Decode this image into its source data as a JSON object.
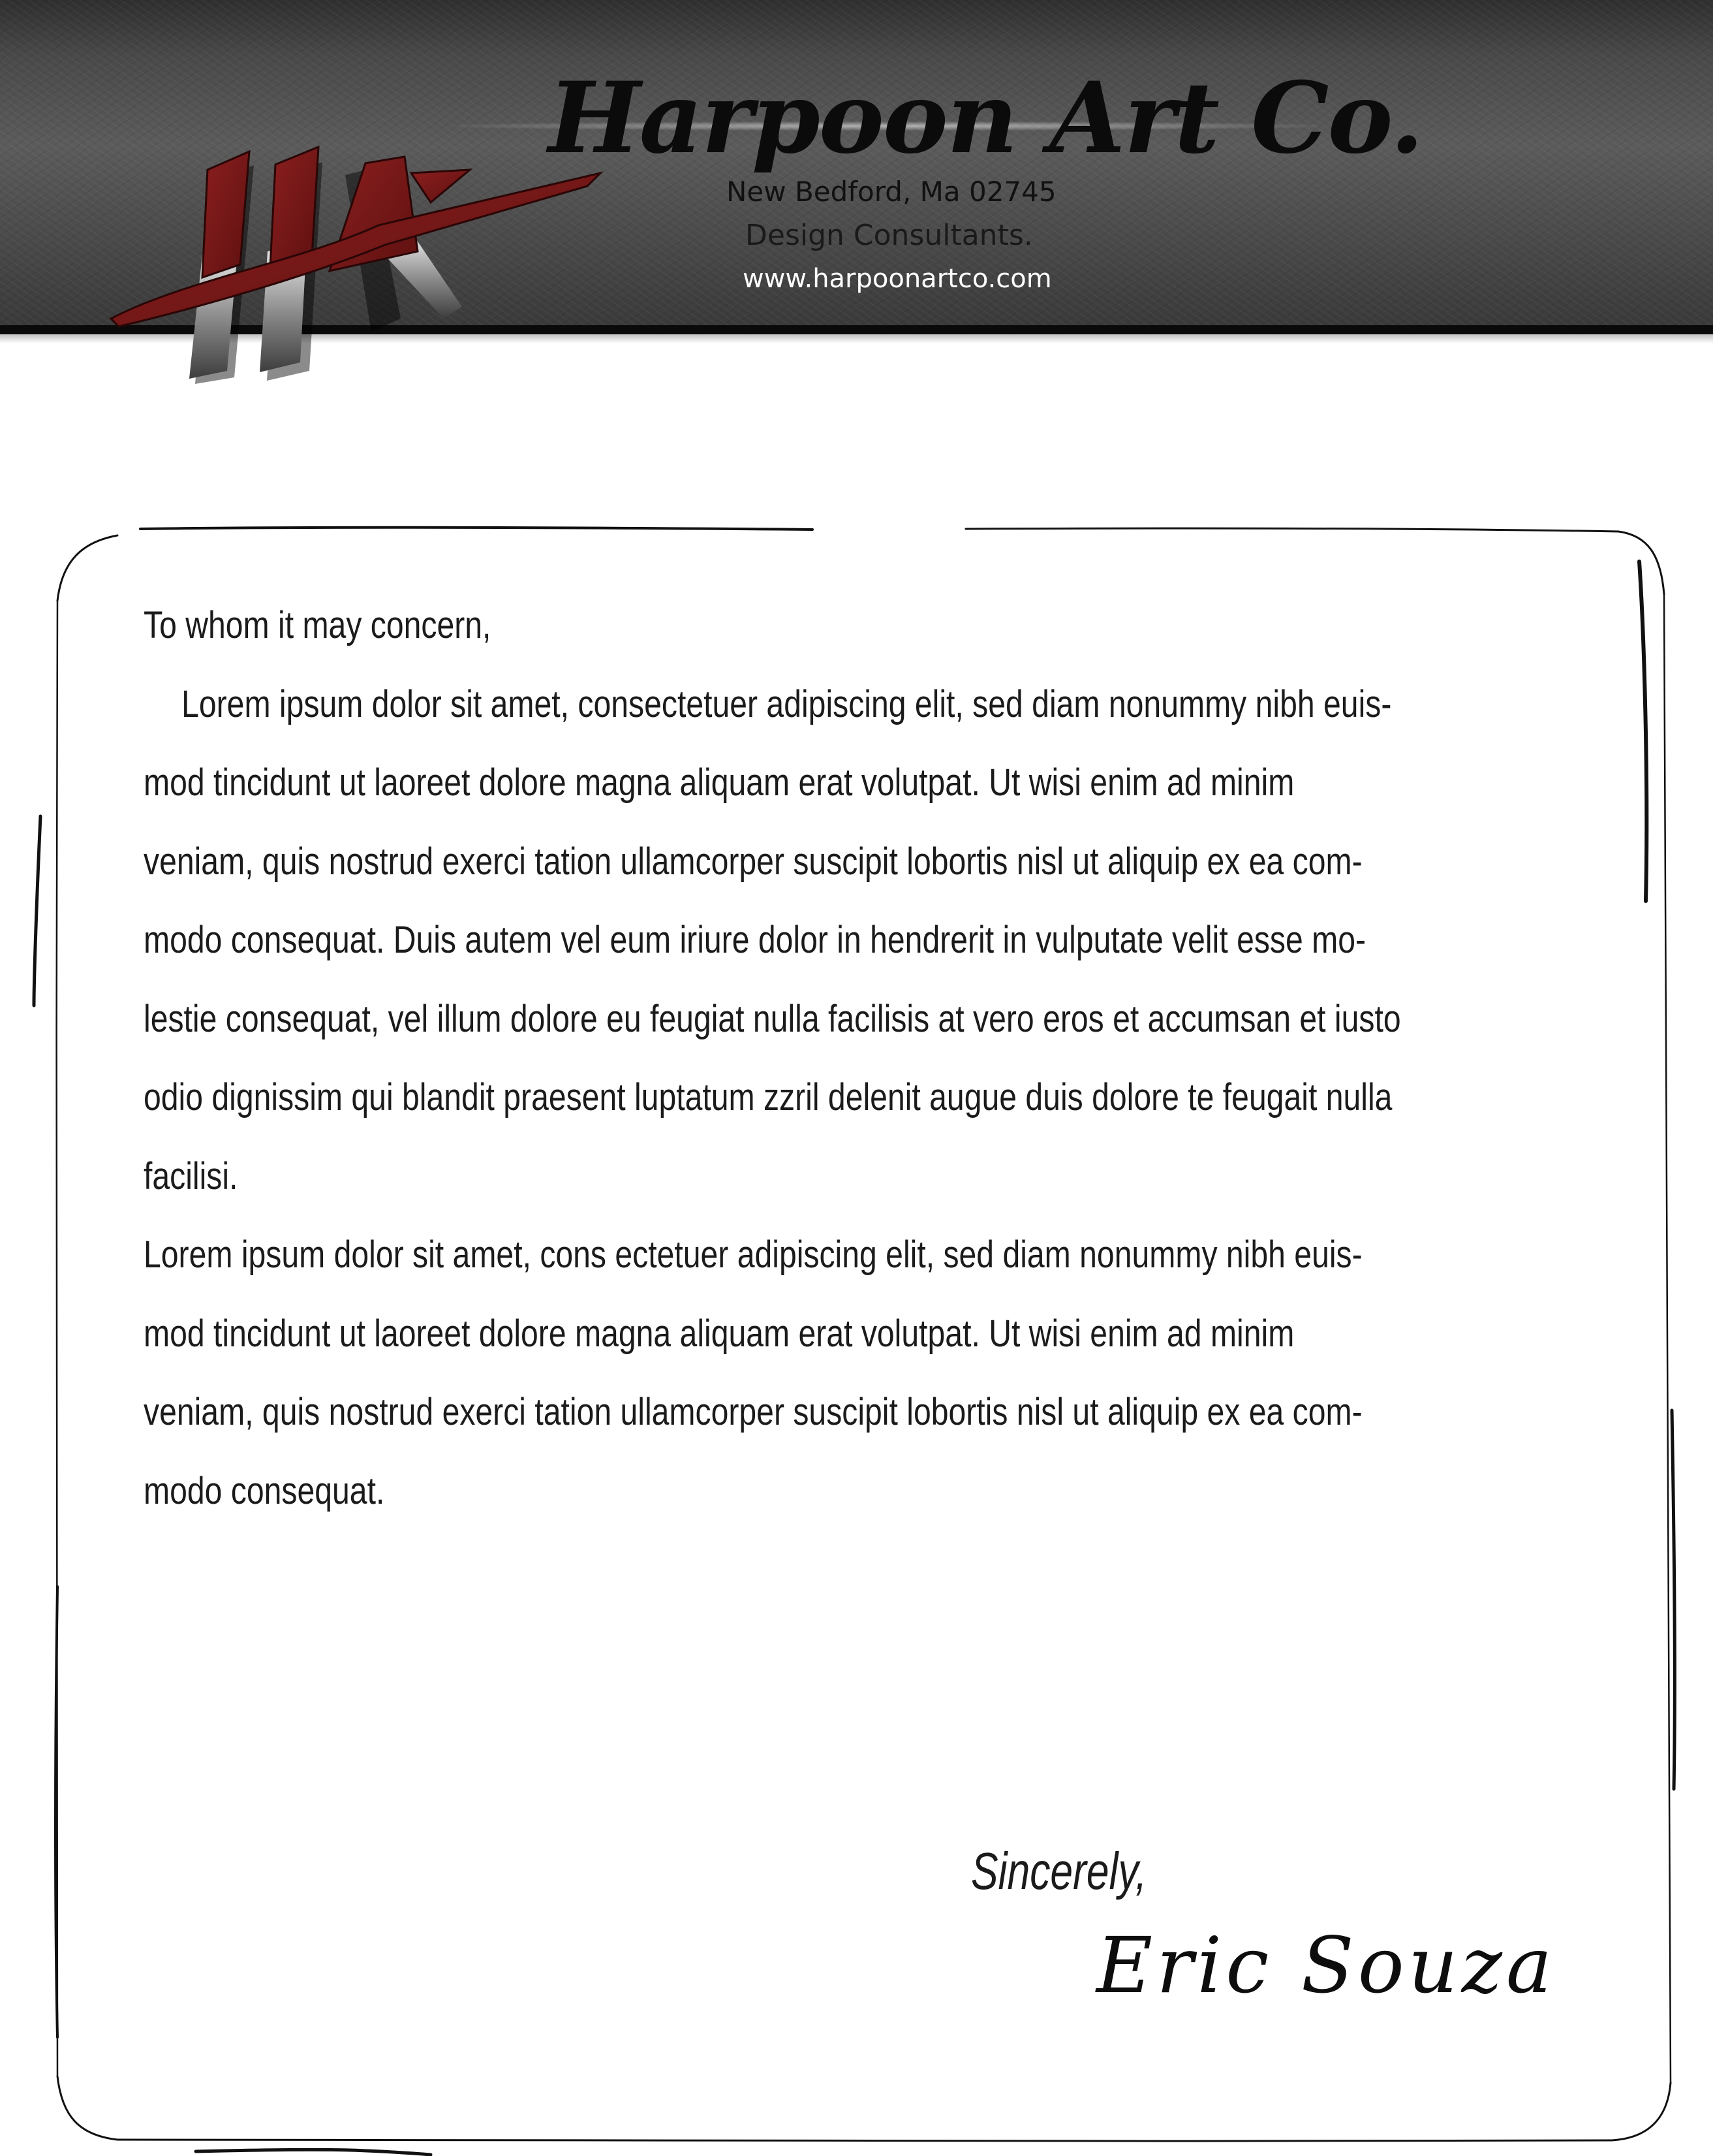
{
  "header": {
    "company_name": "Harpoon Art Co.",
    "address": "New Bedford, Ma 02745",
    "tagline": "Design Consultants.",
    "website": "www.harpoonartco.com",
    "logo_monogram": "HA",
    "accent_color": "#7a1a1a"
  },
  "letter": {
    "salutation": "To whom it may concern,",
    "paragraph_1_lines": [
      "Lorem ipsum dolor sit amet, consectetuer adipiscing elit, sed diam nonummy nibh euis-",
      "mod tincidunt ut laoreet dolore magna aliquam erat volutpat. Ut wisi enim ad minim",
      "veniam, quis nostrud exerci tation ullamcorper suscipit lobortis nisl ut aliquip ex ea com-",
      "modo consequat. Duis autem vel eum iriure dolor in hendrerit in vulputate velit esse mo-",
      "lestie consequat, vel illum dolore eu feugiat nulla facilisis at vero eros et accumsan et iusto",
      "odio dignissim qui blandit praesent luptatum zzril delenit augue duis dolore te feugait nulla",
      "facilisi."
    ],
    "paragraph_2_lines": [
      "Lorem ipsum dolor sit amet, cons ectetuer adipiscing elit, sed diam nonummy nibh euis-",
      "mod tincidunt ut laoreet dolore magna aliquam erat volutpat. Ut wisi enim ad minim",
      "veniam, quis nostrud exerci tation ullamcorper suscipit lobortis nisl ut aliquip ex ea com-",
      "modo consequat."
    ],
    "closing": "Sincerely,",
    "signature": "Eric Souza"
  }
}
